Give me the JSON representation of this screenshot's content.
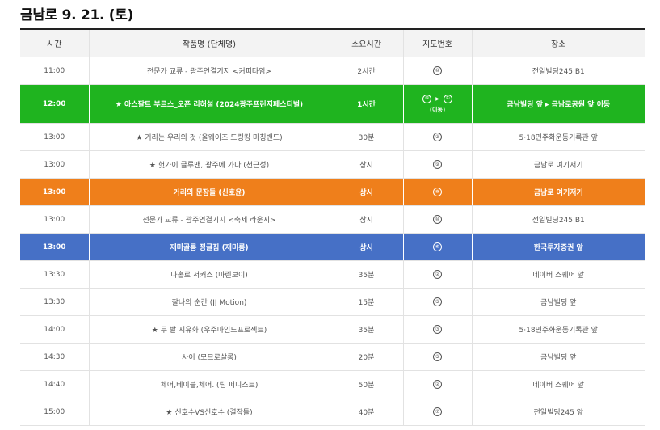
{
  "title": "금남로 9. 21. (토)",
  "columns": [
    "시간",
    "작품명 (단체명)",
    "소요시간",
    "지도번호",
    "장소"
  ],
  "rows": [
    {
      "time": "11:00",
      "title": "전문가 교류 - 광주연결기지 <커피타임>",
      "duration": "2시간",
      "map": "⑩",
      "place": "전일빌딩245 B1"
    },
    {
      "time": "12:00",
      "title": "★ 아스팔트 부르스_오픈 리허설 (2024광주프린지페스티벌)",
      "duration": "1시간",
      "map_from": "⑤",
      "map_arrow": "▶",
      "map_to": "①",
      "map_note": "(이동)",
      "place": "금남빌딩 앞 ▸ 금남로공원 앞 이동"
    },
    {
      "time": "13:00",
      "title": "★ 거리는 우리의 것 (올웨이즈 드링킹 마칭밴드)",
      "duration": "30분",
      "map": "③",
      "place": "5·18민주화운동기록관 앞"
    },
    {
      "time": "13:00",
      "title": "★ 헛가이 글루맨, 광주에 가다 (천근성)",
      "duration": "상시",
      "map": "⑨",
      "place": "금남로 여기저기"
    },
    {
      "time": "13:00",
      "title": "거리의 문장들 (신호윤)",
      "duration": "상시",
      "map": "⑨",
      "place": "금남로 여기저기"
    },
    {
      "time": "13:00",
      "title": "전문가 교류 - 광주연결기지 <축제 라운지>",
      "duration": "상시",
      "map": "⑩",
      "place": "전일빌딩245 B1"
    },
    {
      "time": "13:00",
      "title": "재미골롱 정글짐 (재미롱)",
      "duration": "상시",
      "map": "⑥",
      "place": "한국투자증권 앞"
    },
    {
      "time": "13:30",
      "title": "나홀로 서커스 (마린보이)",
      "duration": "35분",
      "map": "②",
      "place": "네이버 스퀘어 앞"
    },
    {
      "time": "13:30",
      "title": "찰나의 순간 (JJ Motion)",
      "duration": "15분",
      "map": "⑤",
      "place": "금남빌딩 앞"
    },
    {
      "time": "14:00",
      "title": "★ 두 발 지유화 (우주마인드프로젝트)",
      "duration": "35분",
      "map": "③",
      "place": "5·18민주화운동기록관 앞"
    },
    {
      "time": "14:30",
      "title": "사이 (모므로살롱)",
      "duration": "20분",
      "map": "⑤",
      "place": "금남빌딩 앞"
    },
    {
      "time": "14:40",
      "title": "체어,테이블,체어. (팀 퍼니스트)",
      "duration": "50분",
      "map": "②",
      "place": "네이버 스퀘어 앞"
    },
    {
      "time": "15:00",
      "title": "★ 신호수VS신호수 (결작들)",
      "duration": "40분",
      "map": "⑦",
      "place": "전일빌딩245 앞"
    }
  ],
  "colors": {
    "green": "#1fb41f",
    "orange": "#ef7f1b",
    "blue": "#4670c6"
  }
}
